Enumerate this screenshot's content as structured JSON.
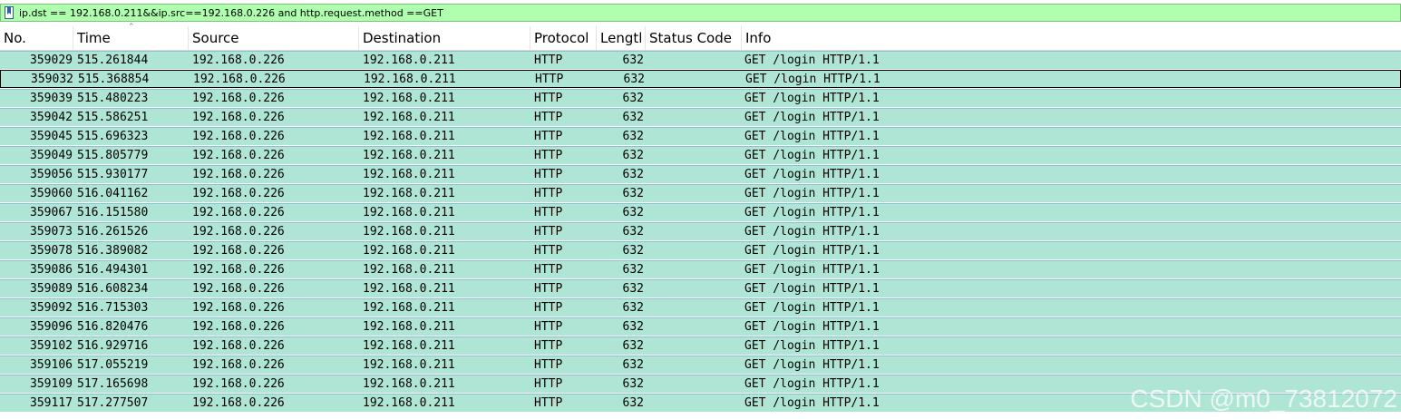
{
  "filter": {
    "icon": "bookmark-icon",
    "expression": "ip.dst == 192.168.0.211&&ip.src==192.168.0.226 and http.request.method ==GET",
    "bg_color": "#afffaf"
  },
  "columns": {
    "no": "No.",
    "time": "Time",
    "source": "Source",
    "destination": "Destination",
    "protocol": "Protocol",
    "length": "Lengtl",
    "status_code": "Status Code",
    "info": "Info"
  },
  "row_color": "#afe5d5",
  "selected_row_index": 1,
  "packets": [
    {
      "no": "359029",
      "time": "515.261844",
      "source": "192.168.0.226",
      "destination": "192.168.0.211",
      "protocol": "HTTP",
      "length": "632",
      "status_code": "",
      "info": "GET /login HTTP/1.1"
    },
    {
      "no": "359032",
      "time": "515.368854",
      "source": "192.168.0.226",
      "destination": "192.168.0.211",
      "protocol": "HTTP",
      "length": "632",
      "status_code": "",
      "info": "GET /login HTTP/1.1"
    },
    {
      "no": "359039",
      "time": "515.480223",
      "source": "192.168.0.226",
      "destination": "192.168.0.211",
      "protocol": "HTTP",
      "length": "632",
      "status_code": "",
      "info": "GET /login HTTP/1.1"
    },
    {
      "no": "359042",
      "time": "515.586251",
      "source": "192.168.0.226",
      "destination": "192.168.0.211",
      "protocol": "HTTP",
      "length": "632",
      "status_code": "",
      "info": "GET /login HTTP/1.1"
    },
    {
      "no": "359045",
      "time": "515.696323",
      "source": "192.168.0.226",
      "destination": "192.168.0.211",
      "protocol": "HTTP",
      "length": "632",
      "status_code": "",
      "info": "GET /login HTTP/1.1"
    },
    {
      "no": "359049",
      "time": "515.805779",
      "source": "192.168.0.226",
      "destination": "192.168.0.211",
      "protocol": "HTTP",
      "length": "632",
      "status_code": "",
      "info": "GET /login HTTP/1.1"
    },
    {
      "no": "359056",
      "time": "515.930177",
      "source": "192.168.0.226",
      "destination": "192.168.0.211",
      "protocol": "HTTP",
      "length": "632",
      "status_code": "",
      "info": "GET /login HTTP/1.1"
    },
    {
      "no": "359060",
      "time": "516.041162",
      "source": "192.168.0.226",
      "destination": "192.168.0.211",
      "protocol": "HTTP",
      "length": "632",
      "status_code": "",
      "info": "GET /login HTTP/1.1"
    },
    {
      "no": "359067",
      "time": "516.151580",
      "source": "192.168.0.226",
      "destination": "192.168.0.211",
      "protocol": "HTTP",
      "length": "632",
      "status_code": "",
      "info": "GET /login HTTP/1.1"
    },
    {
      "no": "359073",
      "time": "516.261526",
      "source": "192.168.0.226",
      "destination": "192.168.0.211",
      "protocol": "HTTP",
      "length": "632",
      "status_code": "",
      "info": "GET /login HTTP/1.1"
    },
    {
      "no": "359078",
      "time": "516.389082",
      "source": "192.168.0.226",
      "destination": "192.168.0.211",
      "protocol": "HTTP",
      "length": "632",
      "status_code": "",
      "info": "GET /login HTTP/1.1"
    },
    {
      "no": "359086",
      "time": "516.494301",
      "source": "192.168.0.226",
      "destination": "192.168.0.211",
      "protocol": "HTTP",
      "length": "632",
      "status_code": "",
      "info": "GET /login HTTP/1.1"
    },
    {
      "no": "359089",
      "time": "516.608234",
      "source": "192.168.0.226",
      "destination": "192.168.0.211",
      "protocol": "HTTP",
      "length": "632",
      "status_code": "",
      "info": "GET /login HTTP/1.1"
    },
    {
      "no": "359092",
      "time": "516.715303",
      "source": "192.168.0.226",
      "destination": "192.168.0.211",
      "protocol": "HTTP",
      "length": "632",
      "status_code": "",
      "info": "GET /login HTTP/1.1"
    },
    {
      "no": "359096",
      "time": "516.820476",
      "source": "192.168.0.226",
      "destination": "192.168.0.211",
      "protocol": "HTTP",
      "length": "632",
      "status_code": "",
      "info": "GET /login HTTP/1.1"
    },
    {
      "no": "359102",
      "time": "516.929716",
      "source": "192.168.0.226",
      "destination": "192.168.0.211",
      "protocol": "HTTP",
      "length": "632",
      "status_code": "",
      "info": "GET /login HTTP/1.1"
    },
    {
      "no": "359106",
      "time": "517.055219",
      "source": "192.168.0.226",
      "destination": "192.168.0.211",
      "protocol": "HTTP",
      "length": "632",
      "status_code": "",
      "info": "GET /login HTTP/1.1"
    },
    {
      "no": "359109",
      "time": "517.165698",
      "source": "192.168.0.226",
      "destination": "192.168.0.211",
      "protocol": "HTTP",
      "length": "632",
      "status_code": "",
      "info": "GET /login HTTP/1.1"
    },
    {
      "no": "359117",
      "time": "517.277507",
      "source": "192.168.0.226",
      "destination": "192.168.0.211",
      "protocol": "HTTP",
      "length": "632",
      "status_code": "",
      "info": "GET /login HTTP/1.1"
    }
  ],
  "watermark": "CSDN @m0_73812072"
}
